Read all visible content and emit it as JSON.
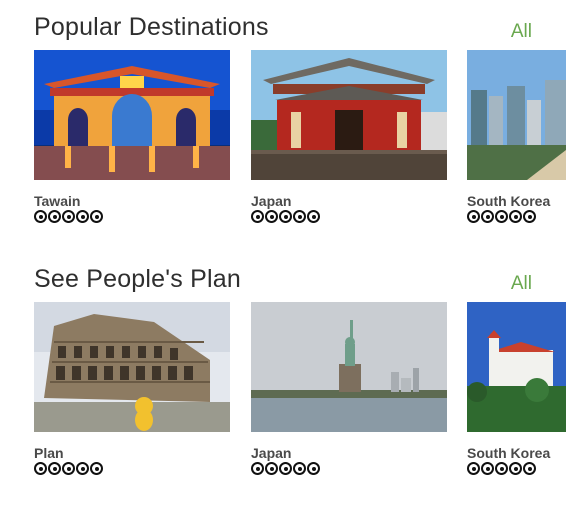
{
  "sections": [
    {
      "title": "Popular Destinations",
      "all_label": "All",
      "cards": [
        {
          "label": "Tawain",
          "rating": 5,
          "image_icon": "taiwan-gate-photo"
        },
        {
          "label": "Japan",
          "rating": 5,
          "image_icon": "japan-temple-photo"
        },
        {
          "label": "South Korea",
          "rating": 5,
          "image_icon": "korea-city-photo"
        }
      ]
    },
    {
      "title": "See People's Plan",
      "all_label": "All",
      "cards": [
        {
          "label": "Plan",
          "rating": 5,
          "image_icon": "colosseum-photo"
        },
        {
          "label": "Japan",
          "rating": 5,
          "image_icon": "statue-of-liberty-photo"
        },
        {
          "label": "South Korea",
          "rating": 5,
          "image_icon": "castle-photo"
        }
      ]
    }
  ],
  "colors": {
    "accent": "#6aa84f",
    "title": "#2f2f2f",
    "label": "#4a4a4a"
  }
}
